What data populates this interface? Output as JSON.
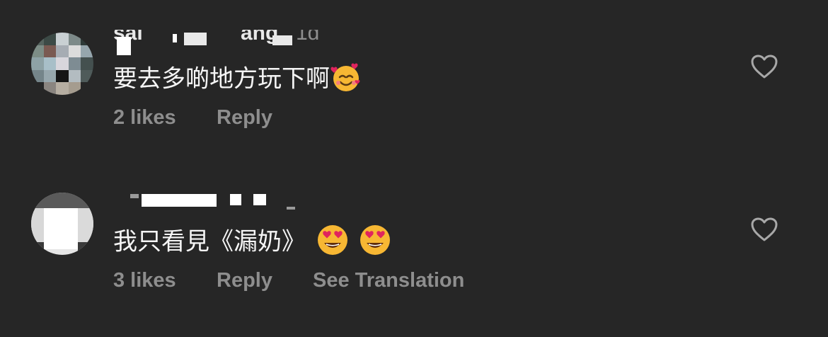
{
  "comments": [
    {
      "username_fragments": {
        "prefix": "sai",
        "suffix": "ang"
      },
      "time": "1d",
      "text": "要去多啲地方玩下啊",
      "emojis": [
        "smiling-face-with-hearts"
      ],
      "likes": "2 likes",
      "reply": "Reply"
    },
    {
      "text": "我只看見《漏奶》",
      "emojis": [
        "heart-eyes",
        "heart-eyes"
      ],
      "likes": "3 likes",
      "reply": "Reply",
      "see_translation": "See Translation"
    }
  ],
  "colors": {
    "background": "#262626",
    "text_primary": "#f5f5f5",
    "text_secondary": "#8e8e8e"
  },
  "icons": [
    "heart-outline-icon"
  ]
}
